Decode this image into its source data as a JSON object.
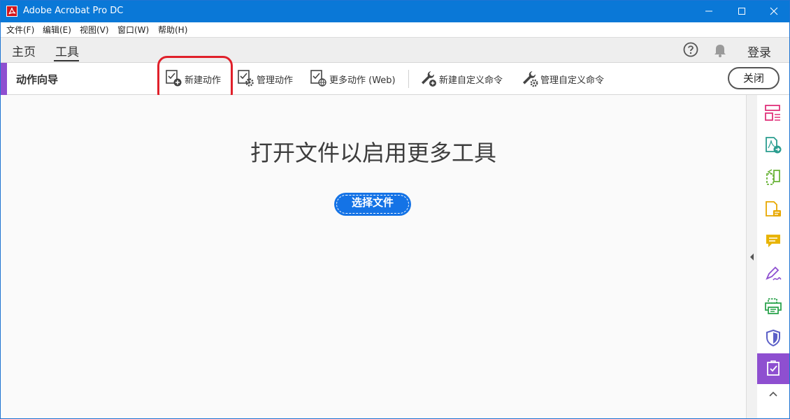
{
  "window": {
    "title": "Adobe Acrobat Pro DC"
  },
  "menu": {
    "items": [
      "文件(F)",
      "编辑(E)",
      "视图(V)",
      "窗口(W)",
      "帮助(H)"
    ]
  },
  "tabs": {
    "home": "主页",
    "tools": "工具",
    "login": "登录"
  },
  "toolbar": {
    "title": "动作向导",
    "new_action": "新建动作",
    "manage_actions": "管理动作",
    "more_actions": "更多动作 (Web)",
    "new_custom_command": "新建自定义命令",
    "manage_custom_commands": "管理自定义命令",
    "close": "关闭"
  },
  "main": {
    "headline": "打开文件以启用更多工具",
    "choose_file": "选择文件"
  },
  "colors": {
    "titlebar": "#0a78d7",
    "accent_purple": "#8e4fd0",
    "button_blue": "#1473e6",
    "highlight_red": "#e0202a"
  },
  "rail": {
    "icons": [
      "organize-pages-icon",
      "export-pdf-icon",
      "edit-pdf-icon",
      "create-pdf-icon",
      "comment-icon",
      "fill-sign-icon",
      "print-production-icon",
      "protect-icon",
      "action-wizard-icon"
    ],
    "active": "action-wizard-icon"
  }
}
